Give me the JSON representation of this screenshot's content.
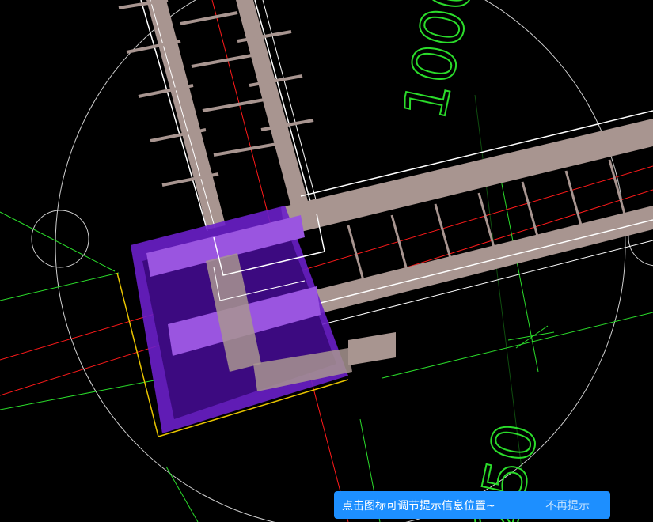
{
  "dimension_labels": [
    "1000",
    "250"
  ],
  "colors": {
    "background": "#000000",
    "rebar": "#a89590",
    "rebar_outline": "#ffffff",
    "column_selected": "#6a1fc9",
    "column_dark": "#3c0a80",
    "grid_red": "#ff1a1a",
    "dim_green": "#2bdc2b",
    "circle_grey": "#cfcfcf",
    "edge_yellow": "#e8c400",
    "tip_bg": "#1d8fff"
  },
  "tip": {
    "message": "点击图标可调节提示信息位置~",
    "dismiss": "不再提示"
  }
}
